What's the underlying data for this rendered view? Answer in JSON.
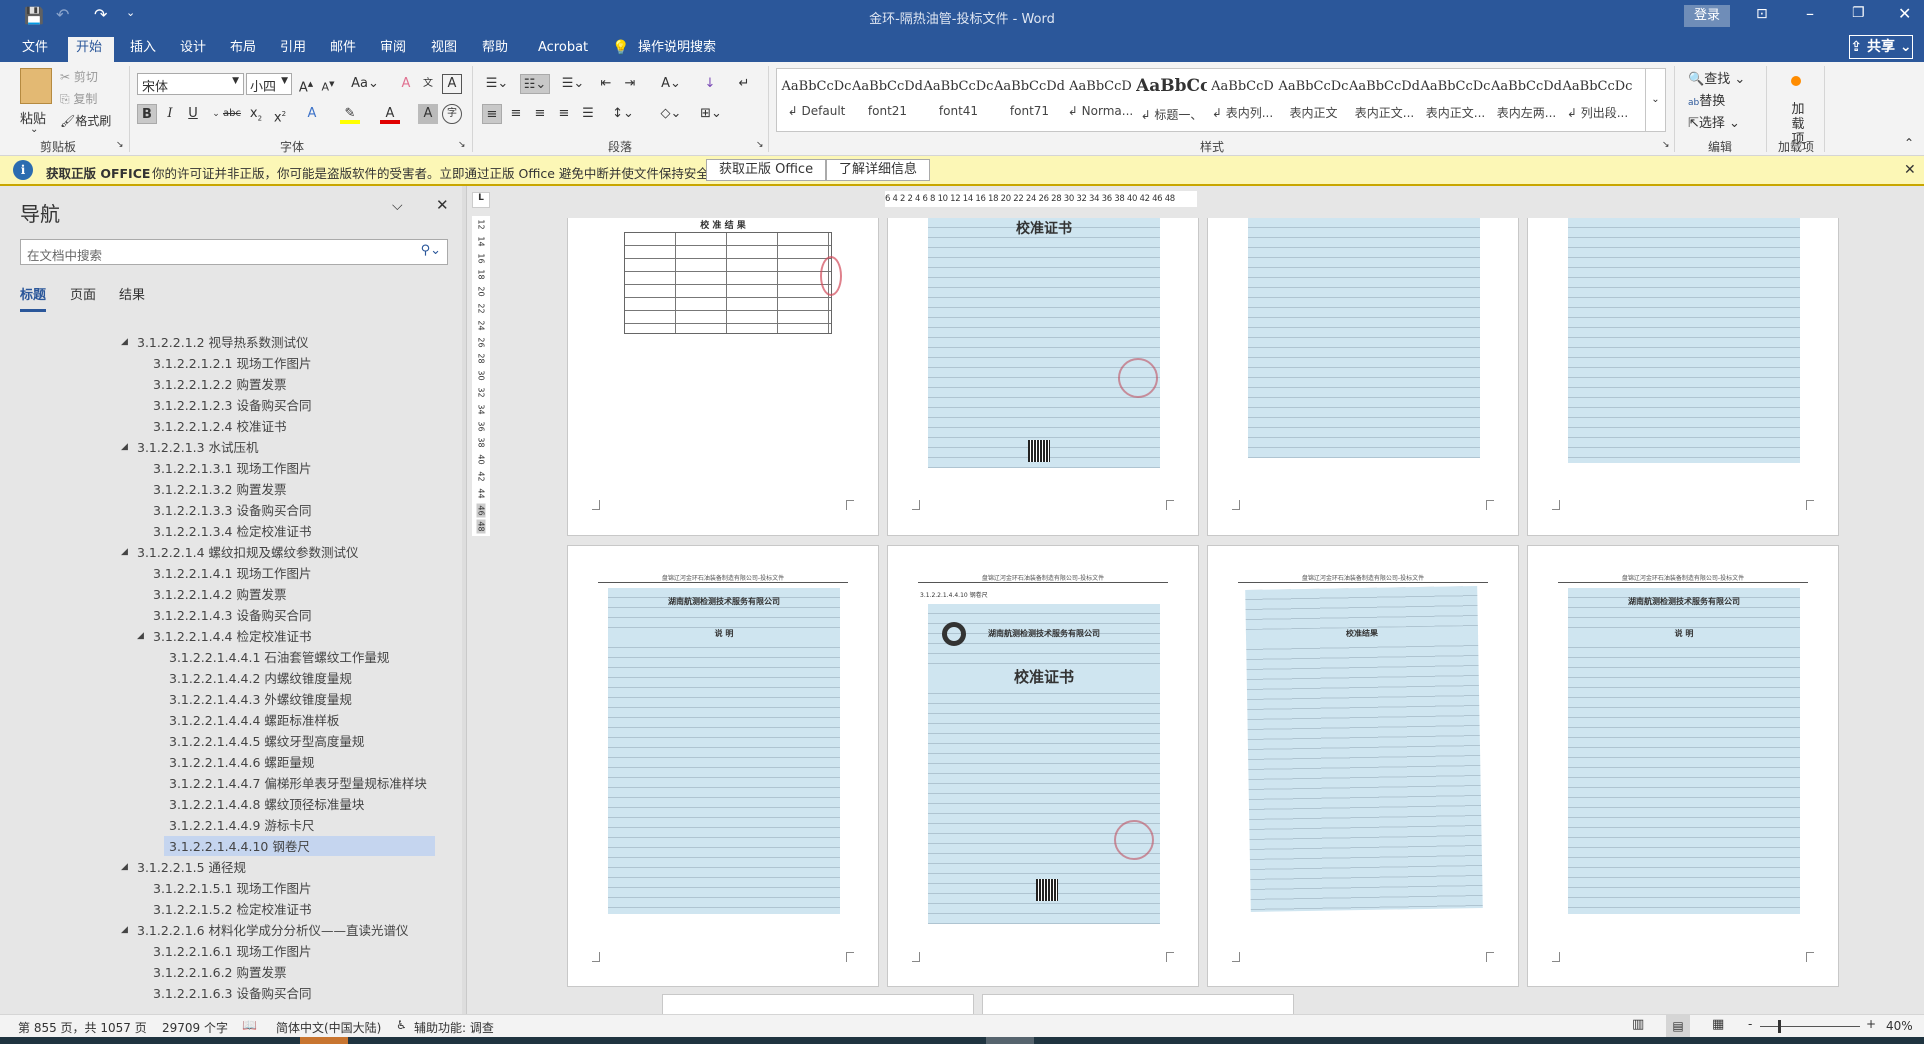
{
  "titlebar": {
    "title": "金环-隔热油管-投标文件  -  Word",
    "login": "登录",
    "share": "共享"
  },
  "tabs": [
    "文件",
    "开始",
    "插入",
    "设计",
    "布局",
    "引用",
    "邮件",
    "审阅",
    "视图",
    "帮助",
    "Acrobat"
  ],
  "tell_me": "操作说明搜索",
  "clipboard": {
    "paste": "粘贴",
    "cut": "剪切",
    "copy": "复制",
    "format_painter": "格式刷",
    "label": "剪贴板"
  },
  "font": {
    "name": "宋体",
    "size": "小四",
    "label": "字体"
  },
  "paragraph": {
    "label": "段落"
  },
  "styles": {
    "label": "样式",
    "items": [
      {
        "preview": "AaBbCcDc",
        "name": "↲ Default"
      },
      {
        "preview": "AaBbCcDdE",
        "name": "font21"
      },
      {
        "preview": "AaBbCcDc",
        "name": "font41"
      },
      {
        "preview": "AaBbCcDdEe",
        "name": "font71"
      },
      {
        "preview": "AaBbCcD",
        "name": "↲ Norma..."
      },
      {
        "preview": "AaBbCc",
        "name": "↲ 标题一、"
      },
      {
        "preview": "AaBbCcD",
        "name": "↲ 表内列..."
      },
      {
        "preview": "AaBbCcDc",
        "name": "表内正文"
      },
      {
        "preview": "AaBbCcDdI",
        "name": "表内正文..."
      },
      {
        "preview": "AaBbCcDc",
        "name": "表内正文..."
      },
      {
        "preview": "AaBbCcDdI",
        "name": "表内左两..."
      },
      {
        "preview": "AaBbCcDc",
        "name": "↲ 列出段..."
      }
    ]
  },
  "editing": {
    "find": "查找",
    "replace": "替换",
    "select": "选择",
    "label": "编辑"
  },
  "addins": {
    "button": "加载项",
    "label": "加载项"
  },
  "message_bar": {
    "title": "获取正版 OFFICE",
    "text": "你的许可证并非正版，你可能是盗版软件的受害者。立即通过正版 Office 避免中断并使文件保持安全。",
    "btn_get": "获取正版 Office",
    "btn_info": "了解详细信息"
  },
  "ruler": {
    "horizontal": "6 4 2  2 4 6 8 10 12 14 16 18 20 22 24 26 28 30 32 34 36 38 40 42  46 48",
    "vertical": [
      "12",
      "14",
      "16",
      "18",
      "20",
      "22",
      "24",
      "26",
      "28",
      "30",
      "32",
      "34",
      "36",
      "38",
      "40",
      "42",
      "44",
      "46",
      "48"
    ]
  },
  "nav": {
    "title": "导航",
    "search_placeholder": "在文档中搜索",
    "tabs": [
      "标题",
      "页面",
      "结果"
    ],
    "items": [
      {
        "level": 2,
        "text": "3.1.2.2.1.2 视导热系数测试仪",
        "expanded": true
      },
      {
        "level": 3,
        "text": "3.1.2.2.1.2.1 现场工作图片"
      },
      {
        "level": 3,
        "text": "3.1.2.2.1.2.2 购置发票"
      },
      {
        "level": 3,
        "text": "3.1.2.2.1.2.3 设备购买合同"
      },
      {
        "level": 3,
        "text": "3.1.2.2.1.2.4 校准证书"
      },
      {
        "level": 2,
        "text": "3.1.2.2.1.3 水试压机",
        "expanded": true
      },
      {
        "level": 3,
        "text": "3.1.2.2.1.3.1 现场工作图片"
      },
      {
        "level": 3,
        "text": "3.1.2.2.1.3.2 购置发票"
      },
      {
        "level": 3,
        "text": "3.1.2.2.1.3.3 设备购买合同"
      },
      {
        "level": 3,
        "text": "3.1.2.2.1.3.4 检定校准证书"
      },
      {
        "level": 2,
        "text": "3.1.2.2.1.4 螺纹扣规及螺纹参数测试仪",
        "expanded": true
      },
      {
        "level": 3,
        "text": "3.1.2.2.1.4.1 现场工作图片"
      },
      {
        "level": 3,
        "text": "3.1.2.2.1.4.2 购置发票"
      },
      {
        "level": 3,
        "text": "3.1.2.2.1.4.3 设备购买合同"
      },
      {
        "level": 3,
        "text": "3.1.2.2.1.4.4 检定校准证书",
        "expanded": true
      },
      {
        "level": 4,
        "text": "3.1.2.2.1.4.4.1 石油套管螺纹工作量规"
      },
      {
        "level": 4,
        "text": "3.1.2.2.1.4.4.2 内螺纹锥度量规"
      },
      {
        "level": 4,
        "text": "3.1.2.2.1.4.4.3 外螺纹锥度量规"
      },
      {
        "level": 4,
        "text": "3.1.2.2.1.4.4.4 螺距标准样板"
      },
      {
        "level": 4,
        "text": "3.1.2.2.1.4.4.5 螺纹牙型高度量规"
      },
      {
        "level": 4,
        "text": "3.1.2.2.1.4.4.6 螺距量规"
      },
      {
        "level": 4,
        "text": "3.1.2.2.1.4.4.7 偏梯形单表牙型量规标准样块"
      },
      {
        "level": 4,
        "text": "3.1.2.2.1.4.4.8 螺纹顶径标准量块"
      },
      {
        "level": 4,
        "text": "3.1.2.2.1.4.4.9 游标卡尺"
      },
      {
        "level": 4,
        "text": "3.1.2.2.1.4.4.10 钢卷尺",
        "selected": true
      },
      {
        "level": 2,
        "text": "3.1.2.2.1.5 通径规",
        "expanded": true
      },
      {
        "level": 3,
        "text": "3.1.2.2.1.5.1 现场工作图片"
      },
      {
        "level": 3,
        "text": "3.1.2.2.1.5.2 检定校准证书"
      },
      {
        "level": 2,
        "text": "3.1.2.2.1.6 材料化学成分分析仪——直读光谱仪",
        "expanded": true
      },
      {
        "level": 3,
        "text": "3.1.2.2.1.6.1 现场工作图片"
      },
      {
        "level": 3,
        "text": "3.1.2.2.1.6.2 购置发票"
      },
      {
        "level": 3,
        "text": "3.1.2.2.1.6.3 设备购买合同"
      }
    ]
  },
  "document": {
    "page_header": "盘锦辽河金环石油装备制造有限公司-投标文件",
    "heading_text": "3.1.2.2.1.4.4.10 钢卷尺",
    "cert_company": "湖南航测检测技术服务有限公司",
    "cert_title": "校准证书",
    "cert_desc": "说 明",
    "results_title": "校 准 结 果",
    "cert_results": "校准结果"
  },
  "status": {
    "page": "第 855 页，共 1057 页",
    "words": "29709 个字",
    "language": "简体中文(中国大陆)",
    "accessibility": "辅助功能: 调查",
    "zoom": "40%",
    "zoom_percent": 40
  },
  "colors": {
    "brand": "#2b579a",
    "message_bar": "#fcf7b6",
    "selection": "#c5d5ef",
    "cert_blue": "#cfe5f0"
  }
}
